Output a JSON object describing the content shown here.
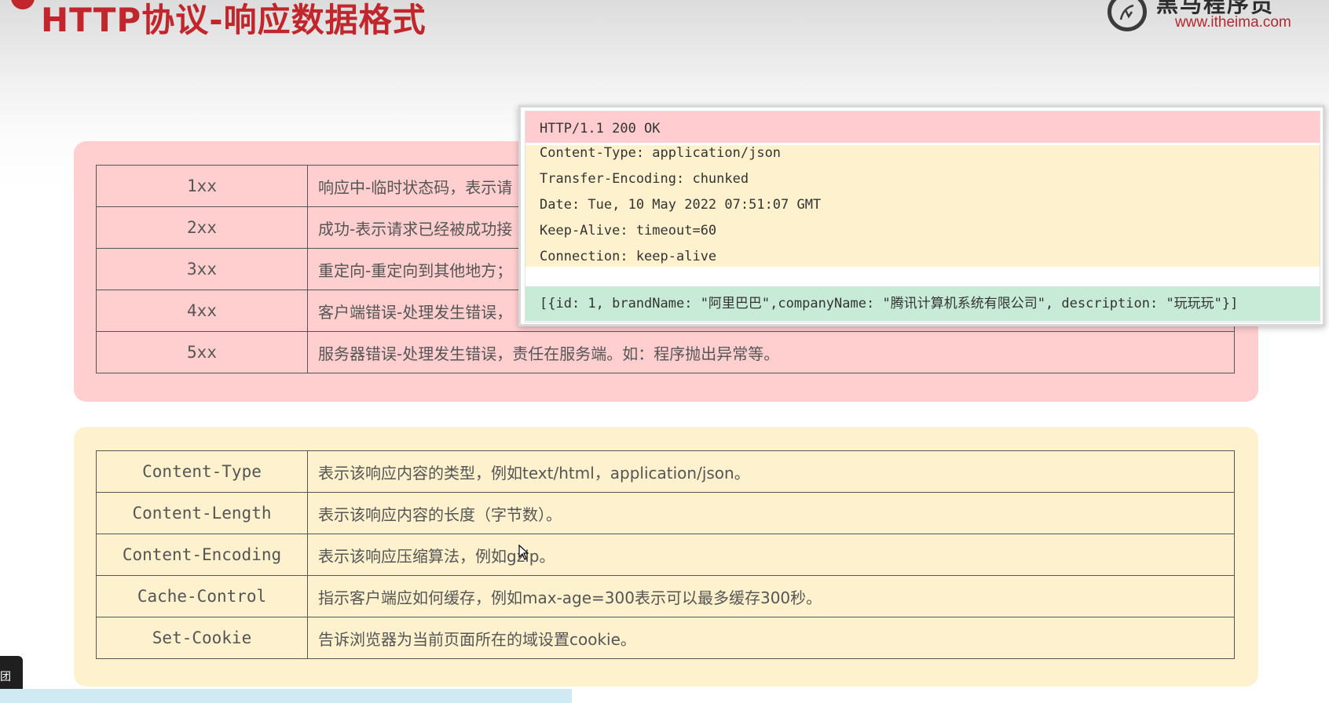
{
  "slide": {
    "title": "HTTP协议-响应数据格式",
    "logo_name": "黑马程序员",
    "logo_url": "www.itheima.com"
  },
  "status_table": {
    "rows": [
      {
        "code": "1xx",
        "desc": "响应中-临时状态码，表示请"
      },
      {
        "code": "2xx",
        "desc": "成功-表示请求已经被成功接"
      },
      {
        "code": "3xx",
        "desc": "重定向-重定向到其他地方；"
      },
      {
        "code": "4xx",
        "desc": "客户端错误-处理发生错误，"
      },
      {
        "code": "5xx",
        "desc": "服务器错误-处理发生错误，责任在服务端。如：程序抛出异常等。"
      }
    ]
  },
  "header_table": {
    "rows": [
      {
        "name": "Content-Type",
        "desc": "表示该响应内容的类型，例如text/html，application/json。"
      },
      {
        "name": "Content-Length",
        "desc": "表示该响应内容的长度（字节数）。"
      },
      {
        "name": "Content-Encoding",
        "desc": "表示该响应压缩算法，例如gzip。"
      },
      {
        "name": "Cache-Control",
        "desc": "指示客户端应如何缓存，例如max-age=300表示可以最多缓存300秒。"
      },
      {
        "name": "Set-Cookie",
        "desc": "告诉浏览器为当前页面所在的域设置cookie。"
      }
    ]
  },
  "response_example": {
    "status_line": "HTTP/1.1 200 OK",
    "headers": [
      "Content-Type: application/json",
      "Transfer-Encoding: chunked",
      "Date: Tue, 10 May 2022 07:51:07 GMT",
      "Keep-Alive: timeout=60",
      "Connection: keep-alive"
    ],
    "body": "[{id: 1, brandName: \"阿里巴巴\",companyName: \"腾讯计算机系统有限公司\", description: \"玩玩玩\"}]"
  },
  "toast": {
    "text": "团"
  },
  "colors": {
    "title": "#c0262b",
    "status_panel": "#ffcfd0",
    "header_panel": "#fef1cd",
    "body_row": "#c7ebd7"
  }
}
